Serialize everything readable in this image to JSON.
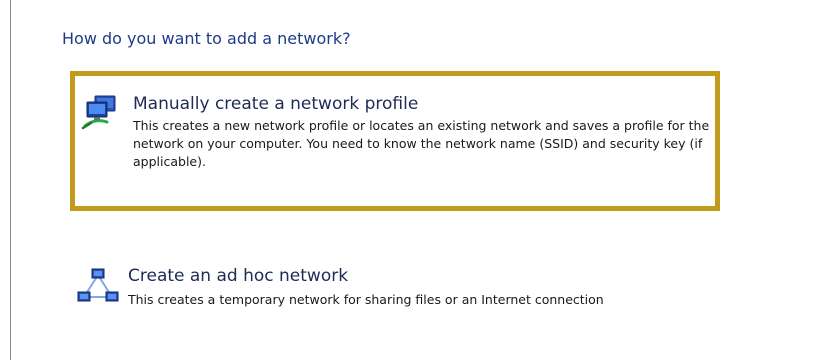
{
  "dialog": {
    "heading": "How do you want to add a network?",
    "options": [
      {
        "title": "Manually create a network profile",
        "description": "This creates a new network profile or locates an existing network and saves a profile for the network on your computer. You need to know the network name (SSID) and security key (if applicable).",
        "icon": "network-computer-icon",
        "highlighted": true
      },
      {
        "title": "Create an ad hoc network",
        "description": "This creates a temporary network for sharing files or an Internet connection",
        "icon": "ad-hoc-network-icon",
        "highlighted": false
      }
    ]
  },
  "colors": {
    "heading": "#1e3b8a",
    "highlight_border": "#c29a1c"
  }
}
